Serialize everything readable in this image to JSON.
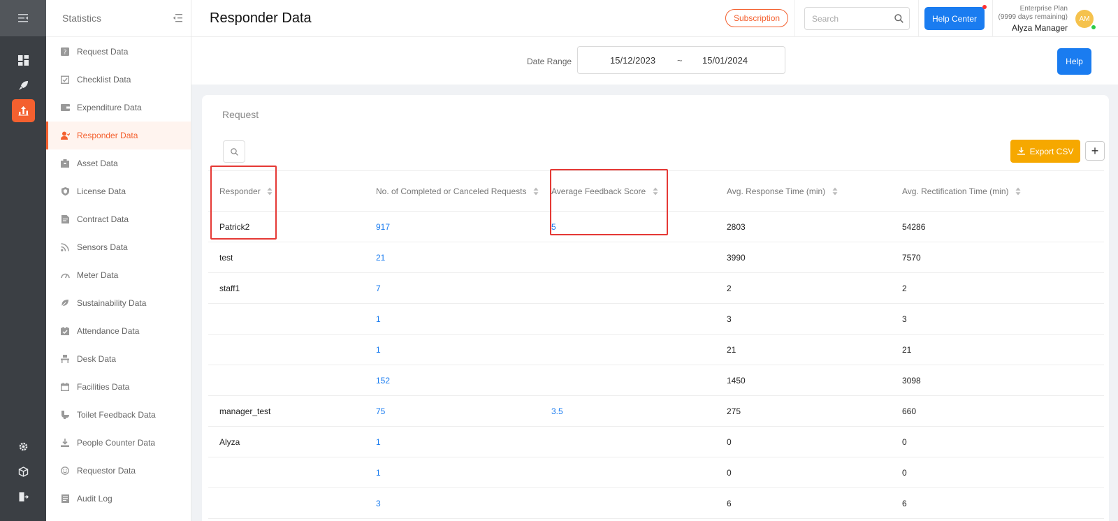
{
  "header": {
    "title": "Responder Data",
    "subscription_label": "Subscription",
    "search_placeholder": "Search",
    "help_center_label": "Help Center",
    "plan_name": "Enterprise Plan",
    "plan_remaining": "(9999 days remaining)",
    "user_name": "Alyza Manager",
    "avatar_initials": "AM"
  },
  "sidebar": {
    "title": "Statistics",
    "items": [
      {
        "label": "Request Data",
        "icon": "question-icon"
      },
      {
        "label": "Checklist Data",
        "icon": "checklist-icon"
      },
      {
        "label": "Expenditure Data",
        "icon": "wallet-icon"
      },
      {
        "label": "Responder Data",
        "icon": "responder-icon"
      },
      {
        "label": "Asset Data",
        "icon": "asset-icon"
      },
      {
        "label": "License Data",
        "icon": "shield-icon"
      },
      {
        "label": "Contract Data",
        "icon": "contract-icon"
      },
      {
        "label": "Sensors Data",
        "icon": "rss-icon"
      },
      {
        "label": "Meter Data",
        "icon": "gauge-icon"
      },
      {
        "label": "Sustainability Data",
        "icon": "leaf-icon"
      },
      {
        "label": "Attendance Data",
        "icon": "calendar-check-icon"
      },
      {
        "label": "Desk Data",
        "icon": "desk-icon"
      },
      {
        "label": "Facilities Data",
        "icon": "calendar-icon"
      },
      {
        "label": "Toilet Feedback Data",
        "icon": "toilet-icon"
      },
      {
        "label": "People Counter Data",
        "icon": "download-icon"
      },
      {
        "label": "Requestor Data",
        "icon": "smile-icon"
      },
      {
        "label": "Audit Log",
        "icon": "document-icon"
      }
    ]
  },
  "filters": {
    "date_range_label": "Date Range",
    "date_from": "15/12/2023",
    "date_separator": "~",
    "date_to": "15/01/2024",
    "help_label": "Help"
  },
  "card": {
    "title": "Request",
    "export_label": "Export CSV",
    "plus_label": "+"
  },
  "table": {
    "columns": [
      "Responder",
      "No. of Completed or Canceled Requests",
      "Average Feedback Score",
      "Avg. Response Time (min)",
      "Avg. Rectification Time (min)"
    ],
    "rows": [
      {
        "responder": "Patrick2",
        "completed": "917",
        "feedback": "5",
        "response": "2803",
        "rectification": "54286"
      },
      {
        "responder": "test",
        "completed": "21",
        "feedback": "",
        "response": "3990",
        "rectification": "7570"
      },
      {
        "responder": "staff1",
        "completed": "7",
        "feedback": "",
        "response": "2",
        "rectification": "2"
      },
      {
        "responder": "",
        "completed": "1",
        "feedback": "",
        "response": "3",
        "rectification": "3"
      },
      {
        "responder": "",
        "completed": "1",
        "feedback": "",
        "response": "21",
        "rectification": "21"
      },
      {
        "responder": "",
        "completed": "152",
        "feedback": "",
        "response": "1450",
        "rectification": "3098"
      },
      {
        "responder": "manager_test",
        "completed": "75",
        "feedback": "3.5",
        "response": "275",
        "rectification": "660"
      },
      {
        "responder": "Alyza",
        "completed": "1",
        "feedback": "",
        "response": "0",
        "rectification": "0"
      },
      {
        "responder": "",
        "completed": "1",
        "feedback": "",
        "response": "0",
        "rectification": "0"
      },
      {
        "responder": "",
        "completed": "3",
        "feedback": "",
        "response": "6",
        "rectification": "6"
      }
    ]
  },
  "colors": {
    "accent": "#f4602f",
    "primary": "#1a7cf0",
    "export": "#f6a800",
    "highlight": "#e53935"
  }
}
